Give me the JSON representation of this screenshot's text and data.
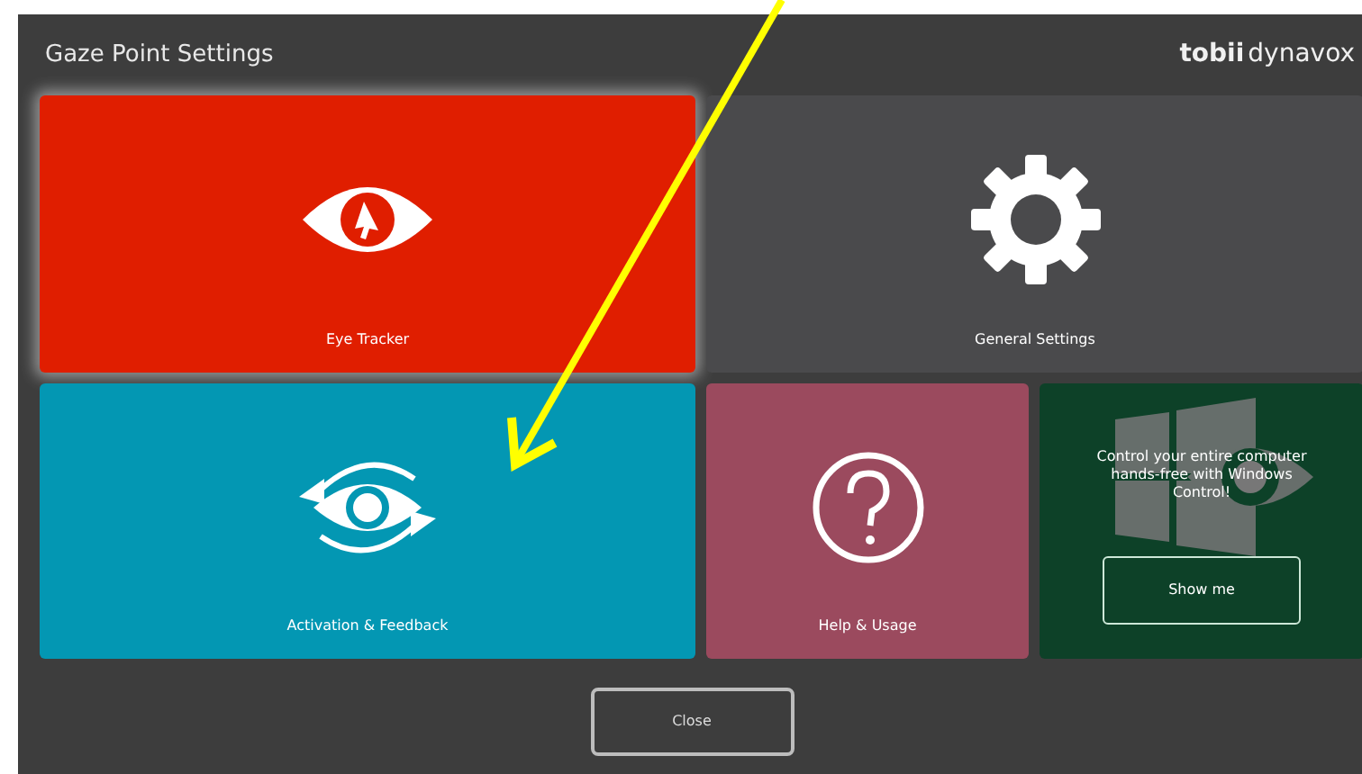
{
  "window": {
    "title": "Gaze Point Settings"
  },
  "logo": {
    "brand": "tobii",
    "sub": "dynavox"
  },
  "tiles": [
    {
      "kind": "eye",
      "label": "Eye Tracker",
      "color": "#e01e00",
      "selected": true
    },
    {
      "kind": "gear",
      "label": "General Settings",
      "color": "#4a4a4c",
      "selected": false
    },
    {
      "kind": "activation",
      "label": "Activation & Feedback",
      "color": "#0397b3",
      "selected": false
    },
    {
      "kind": "help",
      "label": "Help & Usage",
      "color": "#9b4a5e",
      "selected": false
    },
    {
      "kind": "promo",
      "text": "Control your entire computer hands-free with Windows Control!",
      "button": "Show me",
      "color": "#0d4128",
      "selected": false
    }
  ],
  "close_button": "Close"
}
